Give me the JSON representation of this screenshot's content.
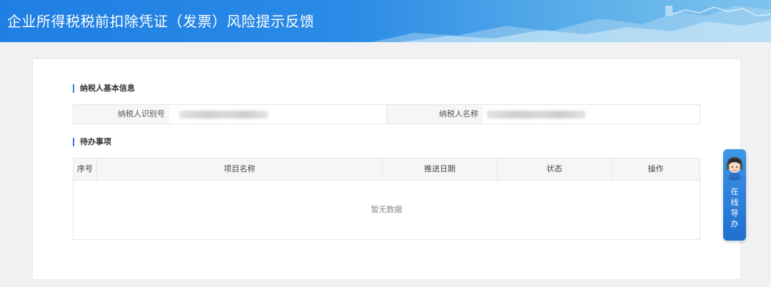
{
  "header": {
    "title": "企业所得税税前扣除凭证（发票）风险提示反馈"
  },
  "taxpayer_section": {
    "title": "纳税人基本信息",
    "id_label": "纳税人识别号",
    "name_label": "纳税人名称"
  },
  "todo_section": {
    "title": "待办事项",
    "columns": [
      "序号",
      "项目名称",
      "推送日期",
      "状态",
      "操作"
    ],
    "empty_text": "暂无数据"
  },
  "guide_widget": {
    "chars": [
      "在",
      "线",
      "导",
      "办"
    ]
  },
  "colors": {
    "header": "#2a8ae6",
    "accent": "#2b7de9",
    "guide": "#1f6fcf"
  }
}
